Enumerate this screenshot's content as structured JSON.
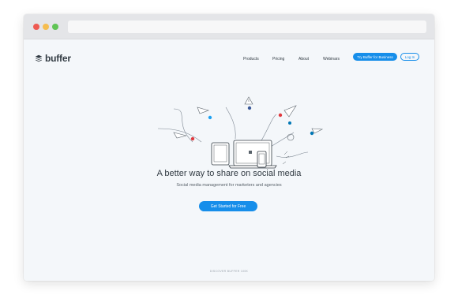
{
  "brand": {
    "name": "buffer"
  },
  "nav": {
    "links": [
      "Products",
      "Pricing",
      "About",
      "Webinars"
    ],
    "business_button": "Try Buffer for Business",
    "login_button": "Log In"
  },
  "hero": {
    "headline": "A better way to share on social media",
    "subheadline": "Social media management for marketers and agencies",
    "cta": "Get Started for Free"
  },
  "footer": {
    "discover": "DISCOVER BUFFER 100K"
  },
  "colors": {
    "accent": "#168eea",
    "text": "#323b43",
    "facebook": "#3b5998",
    "twitter": "#1da1f2",
    "pinterest": "#e0393e",
    "linkedin": "#0077b5"
  },
  "icons": [
    "buffer-logo-icon",
    "paper-plane-icon",
    "laptop-icon",
    "tablet-icon",
    "phone-icon",
    "facebook-icon",
    "twitter-icon",
    "pinterest-icon",
    "linkedin-icon"
  ]
}
